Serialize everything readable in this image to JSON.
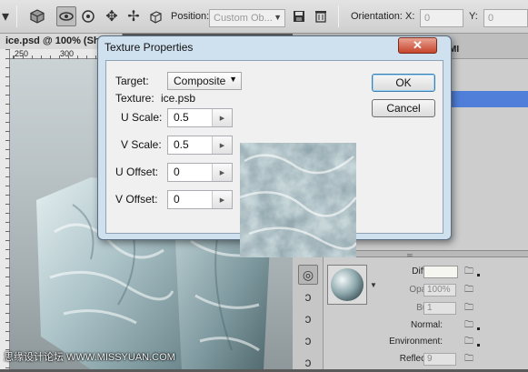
{
  "options_bar": {
    "position_label": "Position:",
    "position_value": "Custom Ob...",
    "orientation_label": "Orientation:",
    "x_label": "X:",
    "x_value": "0",
    "y_label": "Y:",
    "y_value": "0"
  },
  "document": {
    "tab_title": "ice.psd @ 100% (Sh",
    "ruler_marks": [
      "250",
      "300"
    ]
  },
  "panel": {
    "tab_label": "MI",
    "material": {
      "diffuse_label": "Diffuse:",
      "opacity_label": "Opacity:",
      "opacity_value": "100%",
      "bump_label": "Bump:",
      "bump_value": "1",
      "normal_label": "Normal:",
      "environment_label": "Environment:",
      "reflection_label": "Reflection:",
      "reflection_value": "9"
    }
  },
  "dialog": {
    "title": "Texture Properties",
    "close_glyph": "✕",
    "target_label": "Target:",
    "target_value": "Composite",
    "texture_label": "Texture:",
    "texture_value": "ice.psb",
    "u_scale_label": "U Scale:",
    "u_scale_value": "0.5",
    "v_scale_label": "V Scale:",
    "v_scale_value": "0.5",
    "u_offset_label": "U Offset:",
    "u_offset_value": "0",
    "v_offset_label": "V Offset:",
    "v_offset_value": "0",
    "ok_label": "OK",
    "cancel_label": "Cancel"
  },
  "watermark": "思缘设计论坛 WWW.MISSYUAN.COM",
  "colors": {
    "dialog_frame": "#cfe0ef",
    "close_button": "#c7442b",
    "selection": "#4f7fd9"
  }
}
